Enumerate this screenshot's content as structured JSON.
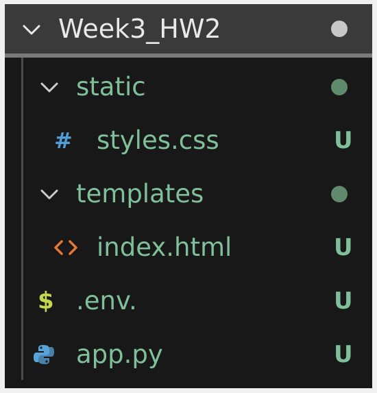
{
  "explorer": {
    "folder": {
      "name": "Week3_HW2",
      "expanded": true,
      "dot_color": "#c8c8c8",
      "chevron_icon": "chevron-down-icon"
    },
    "items": [
      {
        "name": "static",
        "type": "folder",
        "expanded": true,
        "dot_color": "#5f8a6c",
        "chevron_icon": "chevron-down-icon"
      },
      {
        "name": "styles.css",
        "type": "file",
        "icon": "css-file-icon",
        "icon_glyph": "#",
        "icon_color": "#4f9fd6",
        "status": "U"
      },
      {
        "name": "templates",
        "type": "folder",
        "expanded": true,
        "dot_color": "#5f8a6c",
        "chevron_icon": "chevron-down-icon"
      },
      {
        "name": "index.html",
        "type": "file",
        "icon": "html-file-icon",
        "icon_glyph": "<>",
        "icon_color": "#e37933",
        "status": "U"
      },
      {
        "name": ".env.",
        "type": "file",
        "icon": "env-file-icon",
        "icon_glyph": "$",
        "icon_color": "#c7d64f",
        "status": "U"
      },
      {
        "name": "app.py",
        "type": "file",
        "icon": "python-file-icon",
        "icon_glyph": "python",
        "icon_color": "#5aa3d9",
        "status": "U"
      }
    ],
    "colors": {
      "panel_bg": "#181818",
      "header_bg": "#3a3a3a",
      "header_text": "#e9e9e9",
      "untracked_text": "#7fc09a"
    }
  }
}
